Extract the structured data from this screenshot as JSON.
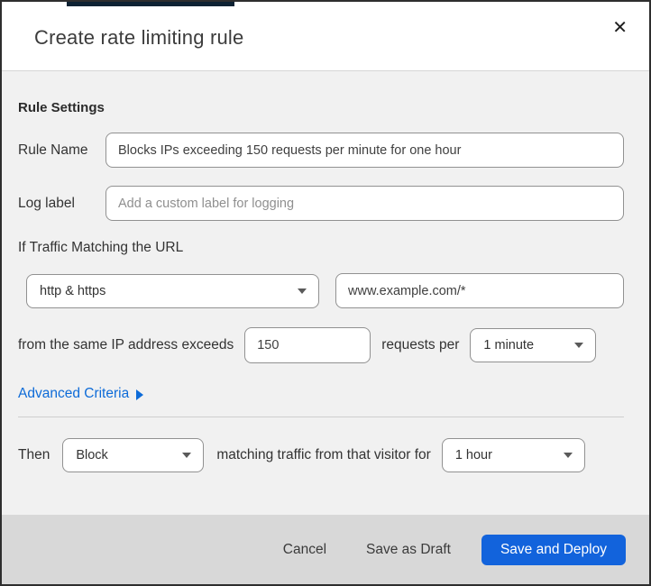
{
  "colors": {
    "link_blue": "#0d6bd8",
    "button_blue": "#1263dc",
    "top_strip": "#0e2233"
  },
  "dialog": {
    "title": "Create rate limiting rule",
    "close_icon": "✕"
  },
  "rule_settings": {
    "heading": "Rule Settings",
    "rule_name": {
      "label": "Rule Name",
      "value": "Blocks IPs exceeding 150 requests per minute for one hour"
    },
    "log_label": {
      "label": "Log label",
      "placeholder": "Add a custom label for logging"
    }
  },
  "traffic": {
    "heading": "If Traffic Matching the URL",
    "scheme_value": "http & https",
    "url_value": "www.example.com/*",
    "exceeds_text": "from the same IP address exceeds",
    "threshold_value": "150",
    "requests_per_text": "requests per",
    "period_value": "1 minute",
    "advanced_link": "Advanced Criteria"
  },
  "then": {
    "label": "Then",
    "action_value": "Block",
    "middle_text": "matching traffic from that visitor for",
    "duration_value": "1 hour"
  },
  "footer": {
    "cancel": "Cancel",
    "save_draft": "Save as Draft",
    "save_deploy": "Save and Deploy"
  }
}
